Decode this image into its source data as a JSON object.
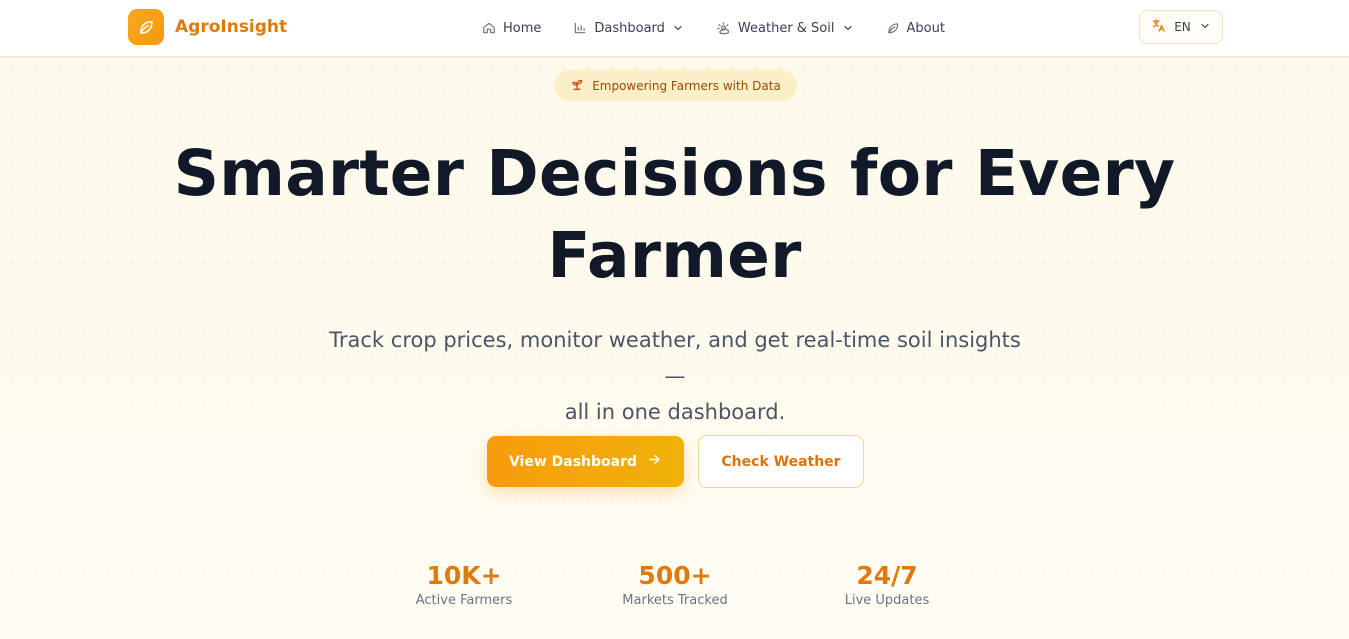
{
  "brand": {
    "name": "AgroInsight",
    "icon": "leaf-icon"
  },
  "nav": {
    "items": [
      {
        "label": "Home",
        "icon": "home-icon",
        "dropdown": false
      },
      {
        "label": "Dashboard",
        "icon": "bar-chart-icon",
        "dropdown": true
      },
      {
        "label": "Weather & Soil",
        "icon": "sun-cloud-icon",
        "dropdown": true
      },
      {
        "label": "About",
        "icon": "leaf-icon",
        "dropdown": false
      }
    ],
    "language": {
      "label": "EN",
      "icon": "translate-icon"
    }
  },
  "hero": {
    "badge": "Empowering Farmers with Data",
    "title_line1": "Smarter Decisions for Every",
    "title_line2": "Farmer",
    "subtitle_line1": "Track crop prices, monitor weather, and get real-time soil insights —",
    "subtitle_line2": "all in one dashboard.",
    "primary_button": "View Dashboard",
    "secondary_button": "Check Weather"
  },
  "stats": [
    {
      "value": "10K+",
      "label": "Active Farmers"
    },
    {
      "value": "500+",
      "label": "Markets Tracked"
    },
    {
      "value": "24/7",
      "label": "Live Updates"
    }
  ],
  "colors": {
    "accent": "#e07a0c",
    "primary_gradient_start": "#f89b0c",
    "primary_gradient_end": "#f0b20a",
    "heading": "#111827",
    "background": "#fefaeb"
  }
}
